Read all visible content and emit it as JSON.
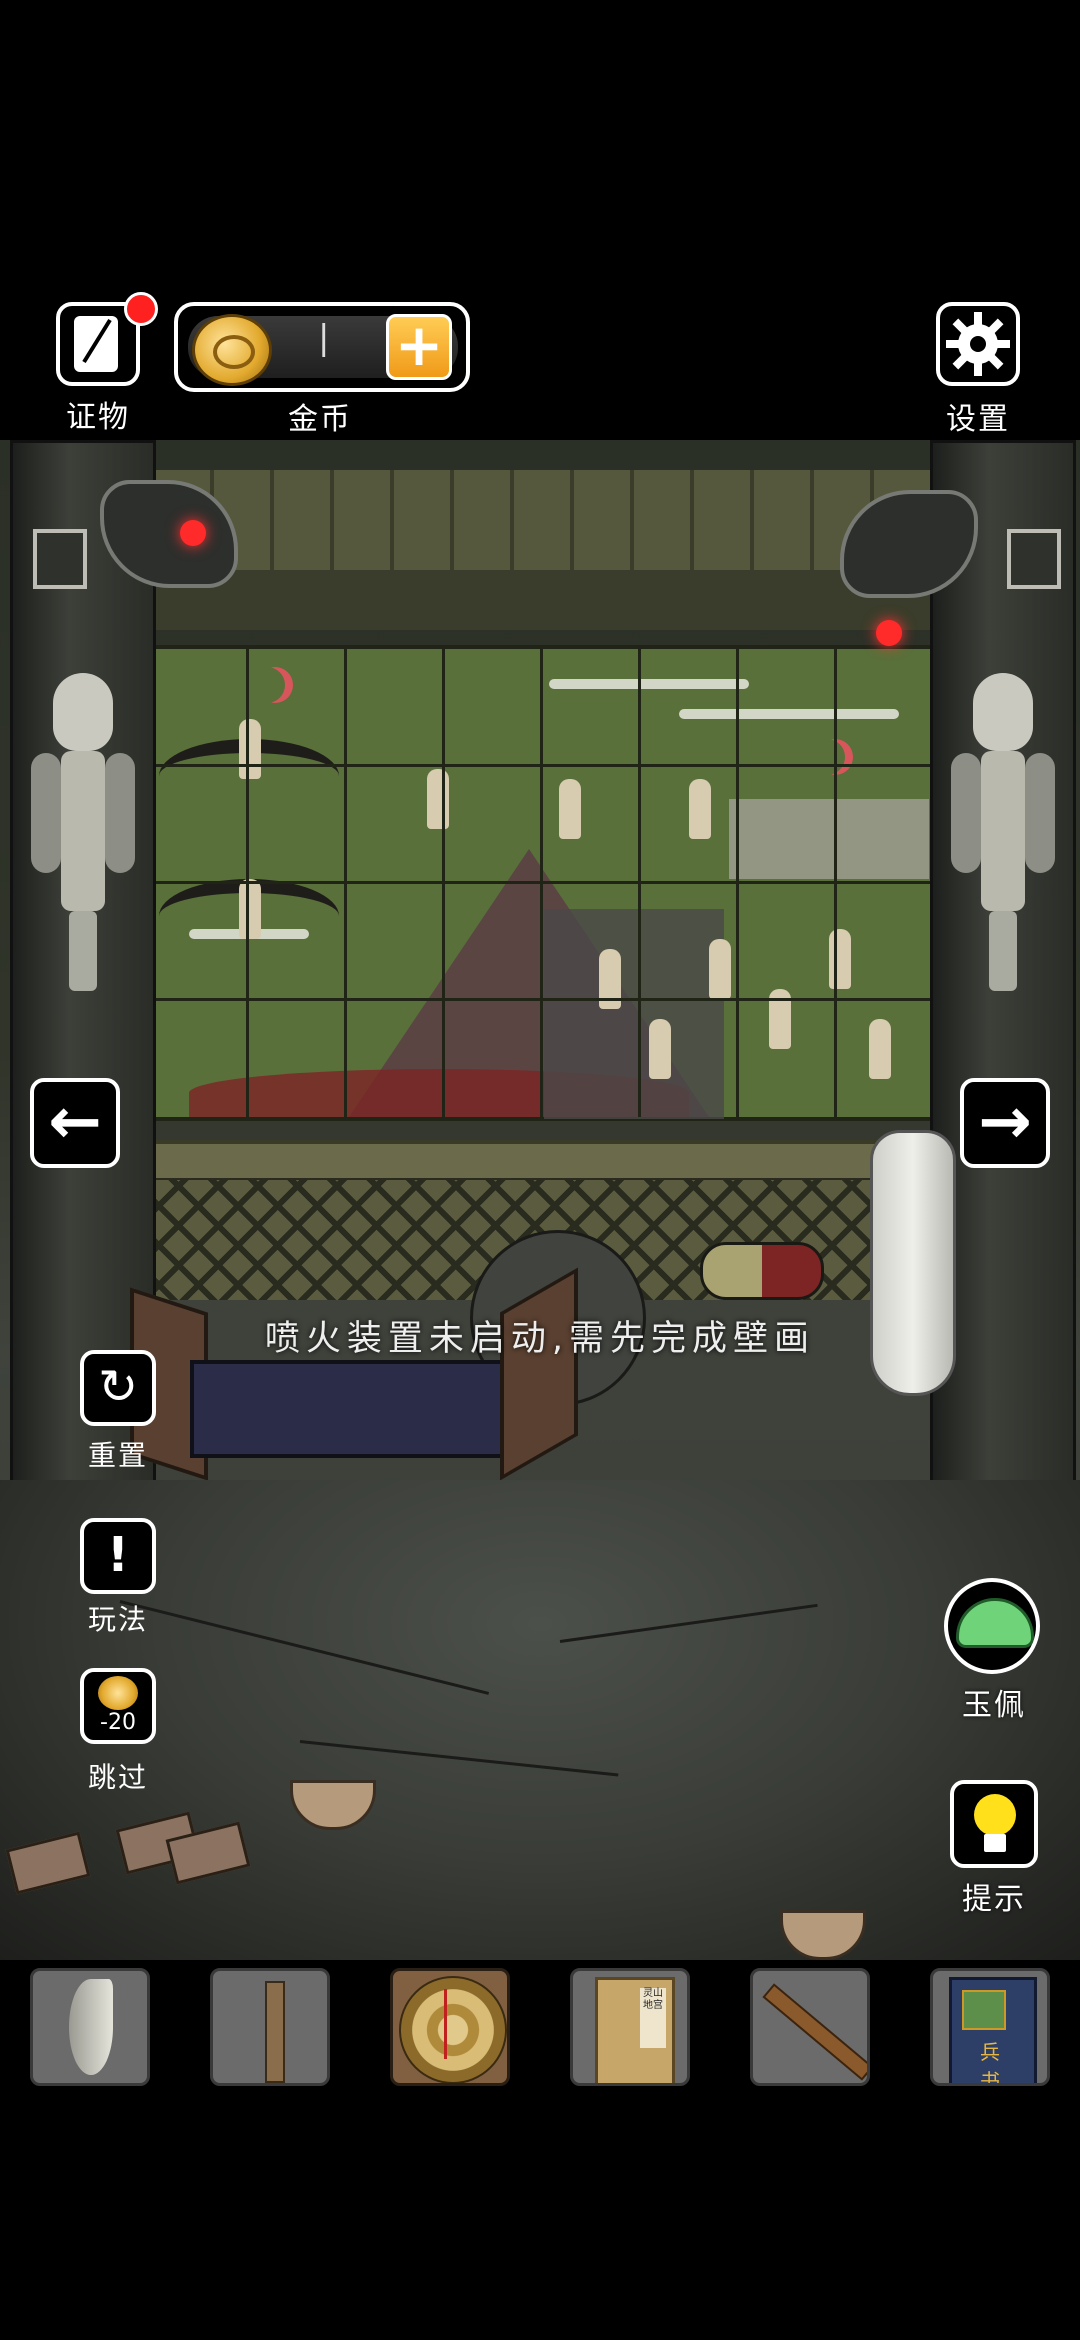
{
  "hud": {
    "evidence_label": "证物",
    "coins_label": "金币",
    "coin_count": "|",
    "plus_symbol": "+",
    "settings_label": "设置",
    "settings_icon": "gear-icon"
  },
  "nav": {
    "left_arrow": "←",
    "right_arrow": "→"
  },
  "side_menu": {
    "reset_label": "重置",
    "howto_label": "玩法",
    "howto_symbol": "!",
    "skip_label": "跳过",
    "skip_cost": "-20",
    "reset_symbol": "↻"
  },
  "right_menu": {
    "jade_label": "玉佩",
    "hint_label": "提示"
  },
  "message": "喷火装置未启动,需先完成壁画",
  "inventory": {
    "items": [
      {
        "name": "tooth-fang",
        "selected": false
      },
      {
        "name": "bamboo-tube",
        "selected": false
      },
      {
        "name": "compass",
        "selected": true
      },
      {
        "name": "book",
        "selected": false,
        "title": "灵山地宫"
      },
      {
        "name": "flute",
        "selected": false
      },
      {
        "name": "bingshu-book",
        "selected": false,
        "title": "兵 书"
      }
    ]
  },
  "colors": {
    "accent_red": "#ff2020",
    "coin_gold": "#e2a92d",
    "plus_orange": "#f09a18",
    "hint_yellow": "#ffe01b",
    "jade_green": "#6fd37a"
  }
}
